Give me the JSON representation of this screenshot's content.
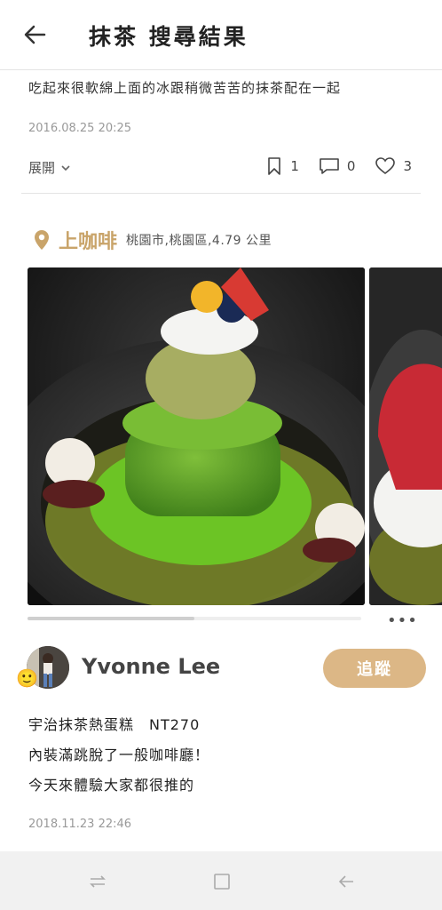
{
  "header": {
    "title": "抹茶 搜尋結果",
    "back_icon": "back-arrow-icon"
  },
  "previous_post": {
    "text": "吃起來很軟綿上面的冰跟稍微苦苦的抹茶配在一起",
    "date": "2016.08.25  20:25",
    "expand_label": "展開",
    "bookmarks": "1",
    "comments": "0",
    "likes": "3"
  },
  "location": {
    "name": "上咖啡",
    "detail": "桃園市,桃園區,4.79 公里",
    "accent_color": "#c9a46a"
  },
  "carousel": {
    "progress": 0.5,
    "more_label": "•••"
  },
  "post": {
    "user_name": "Yvonne Lee",
    "follow_label": "追蹤",
    "follow_color": "#dcb786",
    "lines": [
      "宇治抹茶熱蛋糕　NT270",
      "內裝滿跳脫了一般咖啡廳！",
      "今天來體驗大家都很推的"
    ],
    "date": "2018.11.23  22:46",
    "badge_emoji": "🙂"
  }
}
